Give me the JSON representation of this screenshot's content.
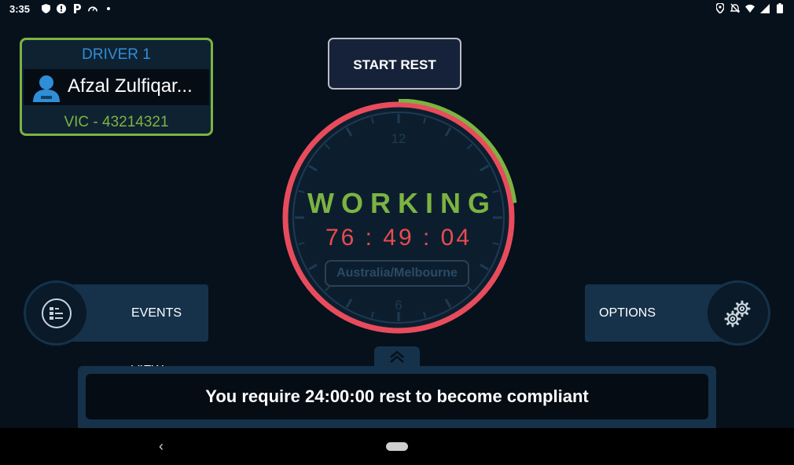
{
  "status_bar": {
    "time": "3:35",
    "left_icons": [
      "shield-icon",
      "alert-icon",
      "parking-icon",
      "speedometer-icon",
      "dot-icon"
    ],
    "right_icons": [
      "location-icon",
      "notifications-off-icon",
      "wifi-icon",
      "signal-icon",
      "battery-icon"
    ]
  },
  "driver": {
    "title": "DRIVER 1",
    "name": "Afzal Zulfiqar...",
    "registration": "VIC - 43214321",
    "border_color": "#7cb342"
  },
  "start_rest": {
    "label": "START REST"
  },
  "clock": {
    "status": "WORKING",
    "timer": "76 : 49 : 04",
    "timezone": "Australia/Melbourne",
    "label_12": "12",
    "label_6": "6",
    "ring_color": "#e84c5c",
    "progress_color": "#7cb342",
    "progress_fraction": 0.23
  },
  "events_view": {
    "label": "EVENTS VIEW",
    "icon": "events-list-icon"
  },
  "options": {
    "label": "OPTIONS",
    "icon": "gears-icon"
  },
  "compliance": {
    "message": "You require 24:00:00 rest to become compliant"
  },
  "navigation": {
    "back_icon": "back-icon",
    "home_icon": "home-pill-icon"
  }
}
